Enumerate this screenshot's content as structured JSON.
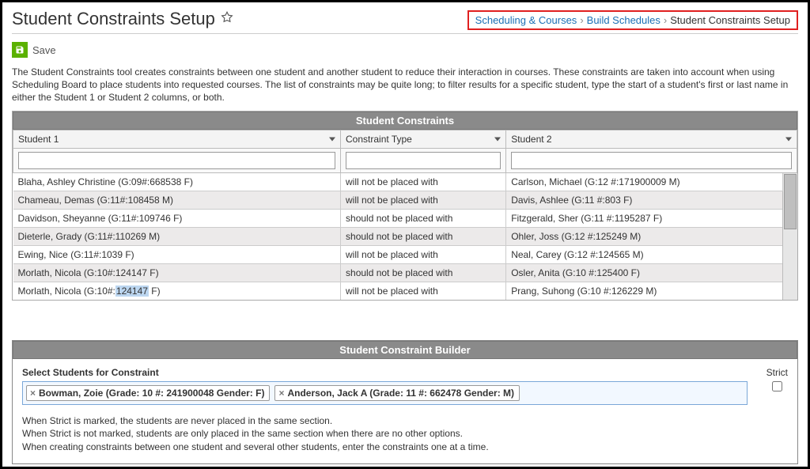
{
  "header": {
    "title": "Student Constraints Setup",
    "breadcrumb": {
      "a": "Scheduling & Courses",
      "b": "Build Schedules",
      "c": "Student Constraints Setup"
    }
  },
  "toolbar": {
    "save": "Save"
  },
  "intro": "The Student Constraints tool creates constraints between one student and another student to reduce their interaction in courses. These constraints are taken into account when using Scheduling Board to place students into requested courses. The list of constraints may be quite long; to filter results for a specific student, type the start of a student's first or last name in either the Student 1 or Student 2 columns, or both.",
  "grid": {
    "title": "Student Constraints",
    "cols": {
      "s1": "Student 1",
      "ct": "Constraint Type",
      "s2": "Student 2"
    },
    "rows": [
      {
        "s1": "Blaha, Ashley Christine (G:09#:668538 F)",
        "ct": "will not be placed with",
        "s2": "Carlson, Michael (G:12 #:171900009 M)"
      },
      {
        "s1": "Chameau, Demas (G:11#:108458 M)",
        "ct": "will not be placed with",
        "s2": "Davis, Ashlee (G:11 #:803 F)"
      },
      {
        "s1": "Davidson, Sheyanne (G:11#:109746 F)",
        "ct": "should not be placed with",
        "s2": "Fitzgerald, Sher (G:11 #:1195287 F)"
      },
      {
        "s1": "Dieterle, Grady (G:11#:110269 M)",
        "ct": "should not be placed with",
        "s2": "Ohler, Joss (G:12 #:125249 M)"
      },
      {
        "s1": "Ewing, Nice (G:11#:1039 F)",
        "ct": "will not be placed with",
        "s2": "Neal, Carey (G:12 #:124565 M)"
      },
      {
        "s1": "Morlath, Nicola (G:10#:124147 F)",
        "ct": "should not be placed with",
        "s2": "Osler, Anita (G:10 #:125400 F)"
      },
      {
        "s1_pre": "Morlath, Nicola (G:10#:",
        "s1_hl": "124147",
        "s1_post": " F)",
        "ct": "will not be placed with",
        "s2": "Prang, Suhong (G:10 #:126229 M)"
      }
    ]
  },
  "builder": {
    "title": "Student Constraint Builder",
    "select_label": "Select Students for Constraint",
    "strict_label": "Strict",
    "tokens": [
      "Bowman, Zoie (Grade: 10 #: 241900048 Gender: F)",
      "Anderson, Jack A (Grade: 11 #: 662478 Gender: M)"
    ],
    "notes": {
      "l1": "When Strict is marked, the students are never placed in the same section.",
      "l2": "When Strict is not marked, students are only placed in the same section when there are no other options.",
      "l3": "When creating constraints between one student and several other students, enter the constraints one at a time."
    }
  }
}
